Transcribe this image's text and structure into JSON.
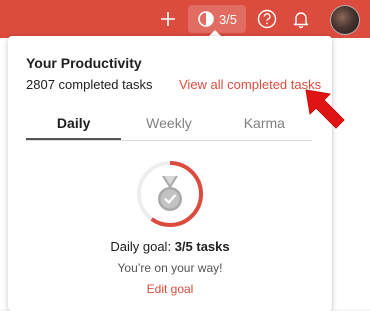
{
  "topbar": {
    "karma_progress": "3/5",
    "icons": [
      "plus-icon",
      "karma-progress-icon",
      "help-icon",
      "bell-icon",
      "avatar"
    ],
    "accent_color": "#db4c3f"
  },
  "panel": {
    "title": "Your Productivity",
    "completed_tasks": "2807 completed tasks",
    "view_all_link": "View all completed tasks",
    "tabs": [
      {
        "label": "Daily",
        "active": true
      },
      {
        "label": "Weekly",
        "active": false
      },
      {
        "label": "Karma",
        "active": false
      }
    ],
    "goal_progress_fraction": 0.6,
    "goal_label": "Daily goal:",
    "goal_value": "3/5 tasks",
    "encouragement": "You’re on your way!",
    "edit_goal_link": "Edit goal"
  }
}
